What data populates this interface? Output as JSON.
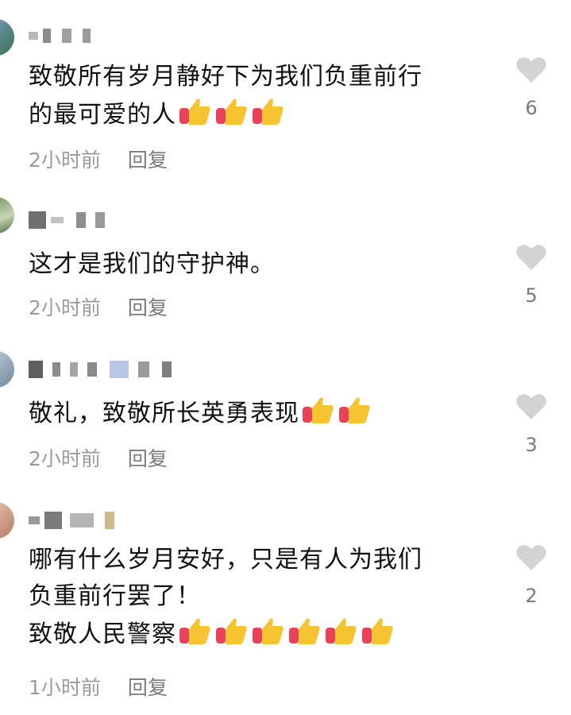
{
  "comments": [
    {
      "text": "致敬所有岁月静好下为我们负重前行\n的最可爱的人",
      "emoji": [
        "thumbs-up",
        "thumbs-up",
        "thumbs-up"
      ],
      "time": "2小时前",
      "reply": "回复",
      "likes": "6"
    },
    {
      "text": "这才是我们的守护神。",
      "emoji": [],
      "time": "2小时前",
      "reply": "回复",
      "likes": "5"
    },
    {
      "text": "敬礼，致敬所长英勇表现",
      "emoji": [
        "thumbs-up",
        "thumbs-up"
      ],
      "time": "2小时前",
      "reply": "回复",
      "likes": "3"
    },
    {
      "text": "哪有什么岁月安好，只是有人为我们\n负重前行罢了！\n致敬人民警察",
      "emoji": [
        "thumbs-up",
        "thumbs-up",
        "thumbs-up",
        "thumbs-up",
        "thumbs-up",
        "thumbs-up"
      ],
      "time": "1小时前",
      "reply": "回复",
      "likes": "2"
    }
  ],
  "colors": {
    "heart": "#d3d3d3",
    "meta_text": "#9b9b9b",
    "thumb_yellow": "#f7c431",
    "thumb_cuff": "#e8435a"
  }
}
